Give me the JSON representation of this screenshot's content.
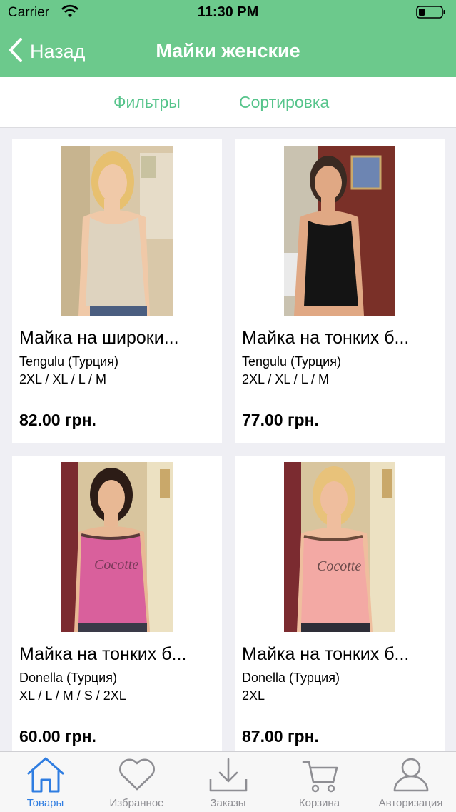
{
  "status_bar": {
    "carrier": "Carrier",
    "time": "11:30 PM"
  },
  "nav": {
    "back_label": "Назад",
    "title": "Майки женские"
  },
  "filters": {
    "filters_label": "Фильтры",
    "sort_label": "Сортировка"
  },
  "products": [
    {
      "name": "Майка на широки...",
      "brand": "Tengulu (Турция)",
      "sizes": "2XL / XL / L / M",
      "price": "82.00 грн."
    },
    {
      "name": "Майка на тонких б...",
      "brand": "Tengulu (Турция)",
      "sizes": "2XL / XL / L / M",
      "price": "77.00 грн."
    },
    {
      "name": "Майка на тонких б...",
      "brand": "Donella (Турция)",
      "sizes": "XL / L / M / S / 2XL",
      "price": "60.00 грн.",
      "logo_text": "Cocotte"
    },
    {
      "name": "Майка на тонких б...",
      "brand": "Donella (Турция)",
      "sizes": "2XL",
      "price": "87.00 грн.",
      "logo_text": "Cocotte"
    }
  ],
  "tabs": [
    {
      "label": "Товары",
      "icon": "home-icon",
      "active": true
    },
    {
      "label": "Избранное",
      "icon": "heart-icon",
      "active": false
    },
    {
      "label": "Заказы",
      "icon": "download-icon",
      "active": false
    },
    {
      "label": "Корзина",
      "icon": "cart-icon",
      "active": false
    },
    {
      "label": "Авторизация",
      "icon": "user-icon",
      "active": false
    }
  ],
  "colors": {
    "accent": "#6cc98c",
    "tab_active": "#2f7de1",
    "link": "#56c48b"
  }
}
